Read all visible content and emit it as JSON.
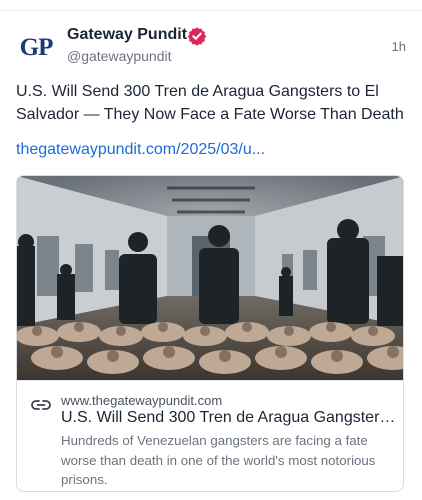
{
  "post": {
    "avatar_text": "GP",
    "display_name": "Gateway Pundit",
    "handle": "@gatewaypundit",
    "timestamp": "1h",
    "text": "U.S. Will Send 300 Tren de Aragua Gangsters to El Salvador — They Now Face a Fate Worse Than Death",
    "link_text": "thegatewaypundit.com/2025/03/u..."
  },
  "card": {
    "domain": "www.thegatewaypundit.com",
    "title": "U.S. Will Send 300 Tren de Aragua Gangsters t...",
    "description": "Hundreds of Venezuelan gangsters are facing a fate worse than death in one of the world's most notorious prisons.",
    "image_alt": "Prison guards in riot gear standing over rows of inmates seated on the floor in a large prison hall"
  },
  "colors": {
    "verified_badge": "#e0275b",
    "link": "#1d6bd9",
    "avatar_text": "#1b3a78"
  }
}
